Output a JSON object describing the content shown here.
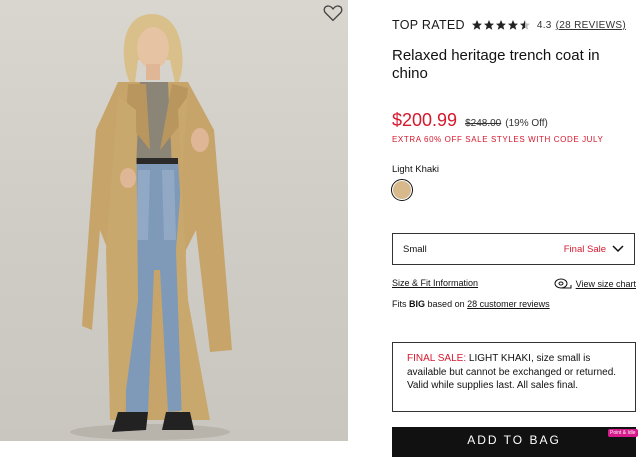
{
  "product": {
    "rated_label": "TOP RATED",
    "rating": "4.3",
    "rating_value": 4.3,
    "reviews_label": "(28 REVIEWS)",
    "title": "Relaxed heritage trench coat in chino",
    "sale_price": "$200.99",
    "original_price": "$248.00",
    "discount": "(19% Off)",
    "promo": "EXTRA 60% OFF SALE STYLES WITH CODE JULY",
    "color_name": "Light Khaki",
    "color_hex": "#d7b98c"
  },
  "size": {
    "selected": "Small",
    "status": "Final Sale",
    "fit_info_label": "Size & Fit Information",
    "chart_label": "View size chart"
  },
  "fits": {
    "prefix": "Fits",
    "fit": "BIG",
    "middle": "based on",
    "reviews_link": "28 customer reviews"
  },
  "final_notice": {
    "label": "FINAL SALE:",
    "text": "LIGHT KHAKI, size small is available but cannot be exchanged or returned. Valid while supplies last. All sales final."
  },
  "cta": {
    "add_to_bag": "ADD TO BAG"
  },
  "badge": {
    "text": "Point & Idle"
  },
  "colors": {
    "accent_red": "#d6182d",
    "khaki": "#d7b98c",
    "button": "#111111"
  }
}
